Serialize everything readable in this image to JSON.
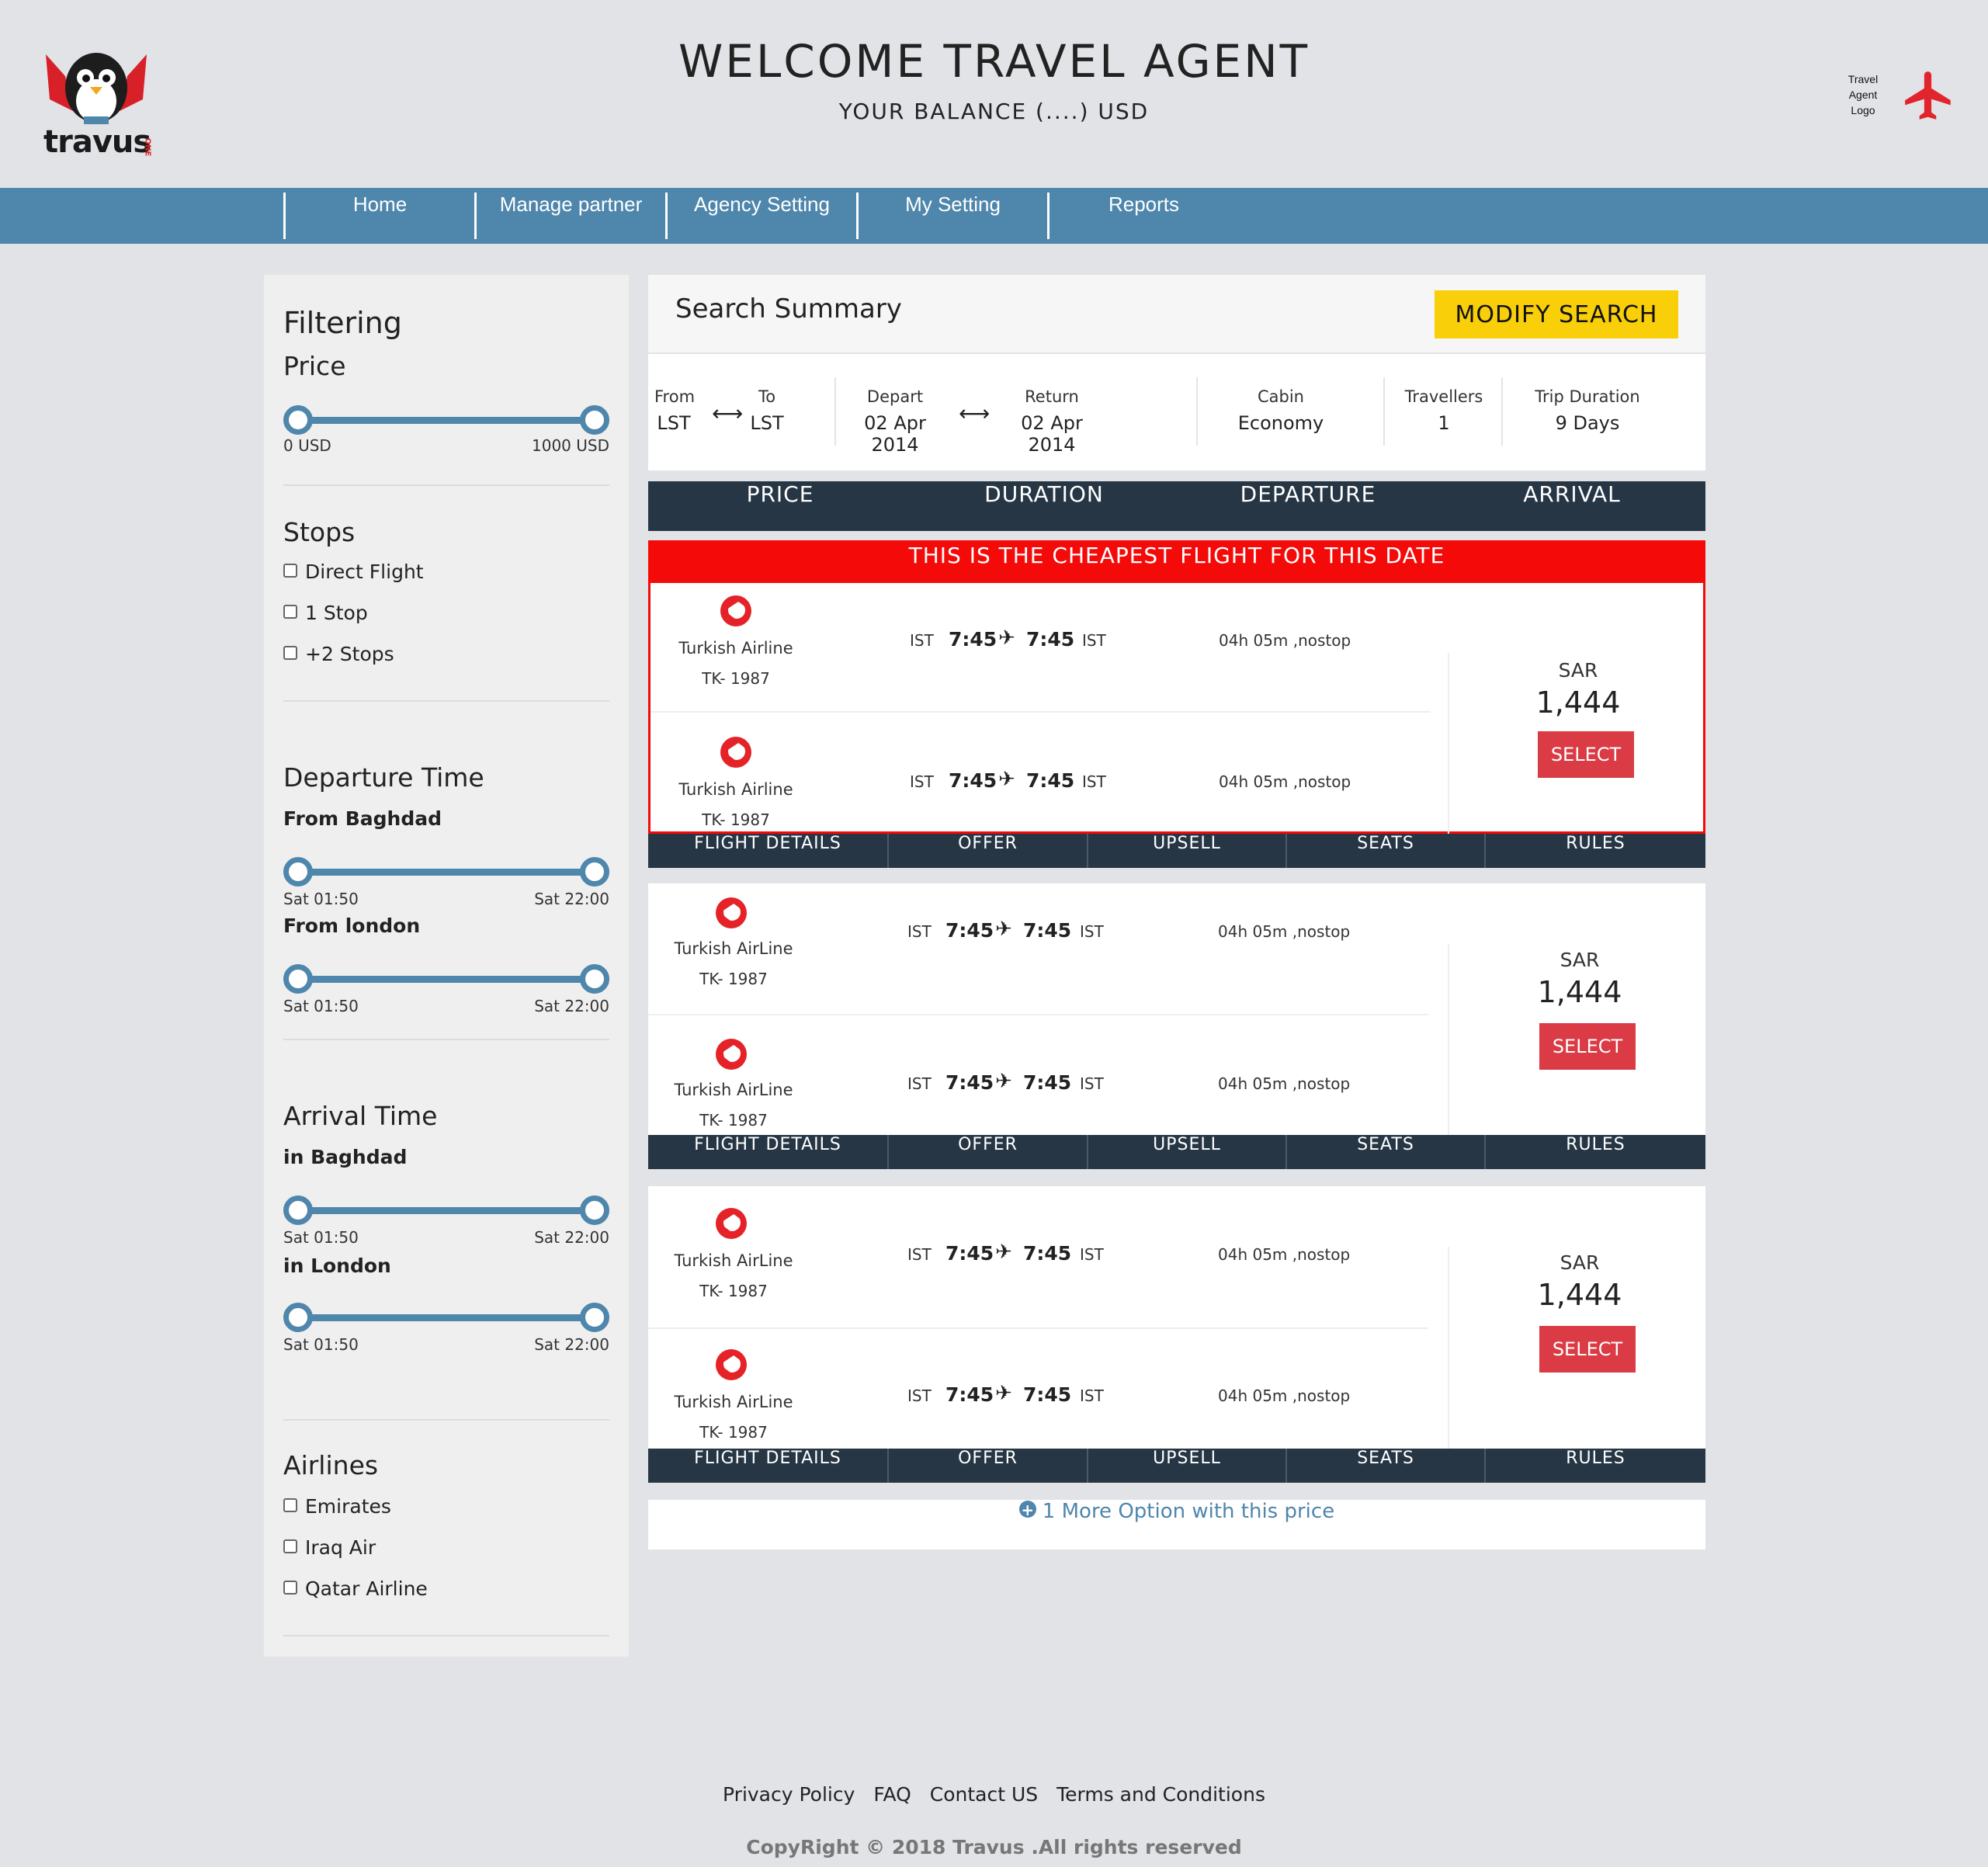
{
  "header": {
    "brand": "travus",
    "brand_sup": "ONE",
    "title": "WELCOME TRAVEL AGENT",
    "balance": "YOUR BALANCE (....) USD",
    "agent_logo": [
      "Travel",
      "Agent",
      "Logo"
    ]
  },
  "nav": [
    "Home",
    "Manage partner",
    "Agency Setting",
    "My Setting",
    "Reports"
  ],
  "filters": {
    "title": "Filtering",
    "price": {
      "label": "Price",
      "min": "0 USD",
      "max": "1000 USD"
    },
    "stops": {
      "label": "Stops",
      "options": [
        "Direct Flight",
        "1 Stop",
        "+2 Stops"
      ]
    },
    "departure": {
      "label": "Departure Time",
      "groups": [
        {
          "label": "From Baghdad",
          "min": "Sat 01:50",
          "max": "Sat 22:00"
        },
        {
          "label": "From london",
          "min": "Sat 01:50",
          "max": "Sat 22:00"
        }
      ]
    },
    "arrival": {
      "label": "Arrival Time",
      "groups": [
        {
          "label": "in Baghdad",
          "min": "Sat 01:50",
          "max": "Sat 22:00"
        },
        {
          "label": "in London",
          "min": "Sat 01:50",
          "max": "Sat 22:00"
        }
      ]
    },
    "airlines": {
      "label": "Airlines",
      "options": [
        "Emirates",
        "Iraq Air",
        "Qatar Airline"
      ]
    }
  },
  "summary": {
    "title": "Search Summary",
    "modify": "MODIFY SEARCH",
    "from": {
      "label": "From",
      "value": "LST"
    },
    "to": {
      "label": "To",
      "value": "LST"
    },
    "depart": {
      "label": "Depart",
      "value": "02 Apr 2014"
    },
    "return": {
      "label": "Return",
      "value": "02 Apr 2014"
    },
    "cabin": {
      "label": "Cabin",
      "value": "Economy"
    },
    "travellers": {
      "label": "Travellers",
      "value": "1"
    },
    "duration": {
      "label": "Trip Duration",
      "value": "9 Days"
    }
  },
  "sort": [
    "PRICE",
    "DURATION",
    "DEPARTURE",
    "ARRIVAL"
  ],
  "cheapest_banner": "THIS IS THE CHEAPEST FLIGHT FOR THIS DATE",
  "results": [
    {
      "legs": [
        {
          "airline": "Turkish Airline",
          "code": "TK- 1987",
          "from": "IST",
          "dep": "7:45",
          "arr": "7:45",
          "to": "IST",
          "duration": "04h 05m ,nostop"
        },
        {
          "airline": "Turkish Airline",
          "code": "TK- 1987",
          "from": "IST",
          "dep": "7:45",
          "arr": "7:45",
          "to": "IST",
          "duration": "04h 05m ,nostop"
        }
      ],
      "currency": "SAR",
      "price": "1,444",
      "select": "SELECT"
    },
    {
      "legs": [
        {
          "airline": "Turkish AirLine",
          "code": "TK- 1987",
          "from": "IST",
          "dep": "7:45",
          "arr": "7:45",
          "to": "IST",
          "duration": "04h 05m ,nostop"
        },
        {
          "airline": "Turkish AirLine",
          "code": "TK- 1987",
          "from": "IST",
          "dep": "7:45",
          "arr": "7:45",
          "to": "IST",
          "duration": "04h 05m ,nostop"
        }
      ],
      "currency": "SAR",
      "price": "1,444",
      "select": "SELECT"
    },
    {
      "legs": [
        {
          "airline": "Turkish AirLine",
          "code": "TK- 1987",
          "from": "IST",
          "dep": "7:45",
          "arr": "7:45",
          "to": "IST",
          "duration": "04h 05m ,nostop"
        },
        {
          "airline": "Turkish AirLine",
          "code": "TK- 1987",
          "from": "IST",
          "dep": "7:45",
          "arr": "7:45",
          "to": "IST",
          "duration": "04h 05m ,nostop"
        }
      ],
      "currency": "SAR",
      "price": "1,444",
      "select": "SELECT"
    }
  ],
  "tabs": [
    "FLIGHT DETAILS",
    "OFFER",
    "UPSELL",
    "SEATS",
    "RULES"
  ],
  "more_option": "1 More Option with this price",
  "footer": {
    "links": [
      "Privacy Policy",
      "FAQ",
      "Contact US",
      "Terms and Conditions"
    ],
    "copyright": "CopyRight © 2018 Travus .All rights reserved"
  },
  "colors": {
    "nav": "#4e86ac",
    "dark": "#263645",
    "cheap": "#f50a0a",
    "select": "#da3b44",
    "modify": "#f9cf0a"
  }
}
